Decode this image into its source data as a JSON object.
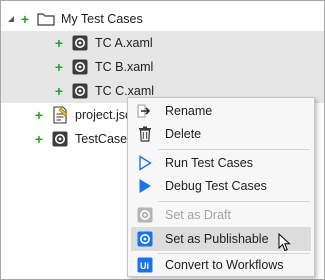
{
  "tree": {
    "items": [
      {
        "label": "My Test Cases",
        "icon": "folder-icon"
      },
      {
        "label": "TC A.xaml",
        "icon": "test-case-icon"
      },
      {
        "label": "TC B.xaml",
        "icon": "test-case-icon"
      },
      {
        "label": "TC C.xaml",
        "icon": "test-case-icon"
      },
      {
        "label": "project.json",
        "icon": "json-file-icon"
      },
      {
        "label": "TestCase.xaml",
        "icon": "test-case-icon"
      }
    ]
  },
  "context_menu": {
    "items": [
      {
        "label": "Rename",
        "icon": "rename-icon",
        "disabled": false
      },
      {
        "label": "Delete",
        "icon": "trash-icon",
        "disabled": false
      },
      {
        "label": "Run Test Cases",
        "icon": "run-outline-icon",
        "disabled": false
      },
      {
        "label": "Debug Test Cases",
        "icon": "debug-filled-icon",
        "disabled": false
      },
      {
        "label": "Set as Draft",
        "icon": "draft-icon",
        "disabled": true
      },
      {
        "label": "Set as Publishable",
        "icon": "publishable-icon",
        "disabled": false
      },
      {
        "label": "Convert to Workflows",
        "icon": "uipath-icon",
        "disabled": false
      }
    ]
  },
  "colors": {
    "plus": "#2e9e2e",
    "accent": "#1a73e8",
    "selection": "#e6e6e6",
    "menu_bg": "#f7f7f7"
  }
}
